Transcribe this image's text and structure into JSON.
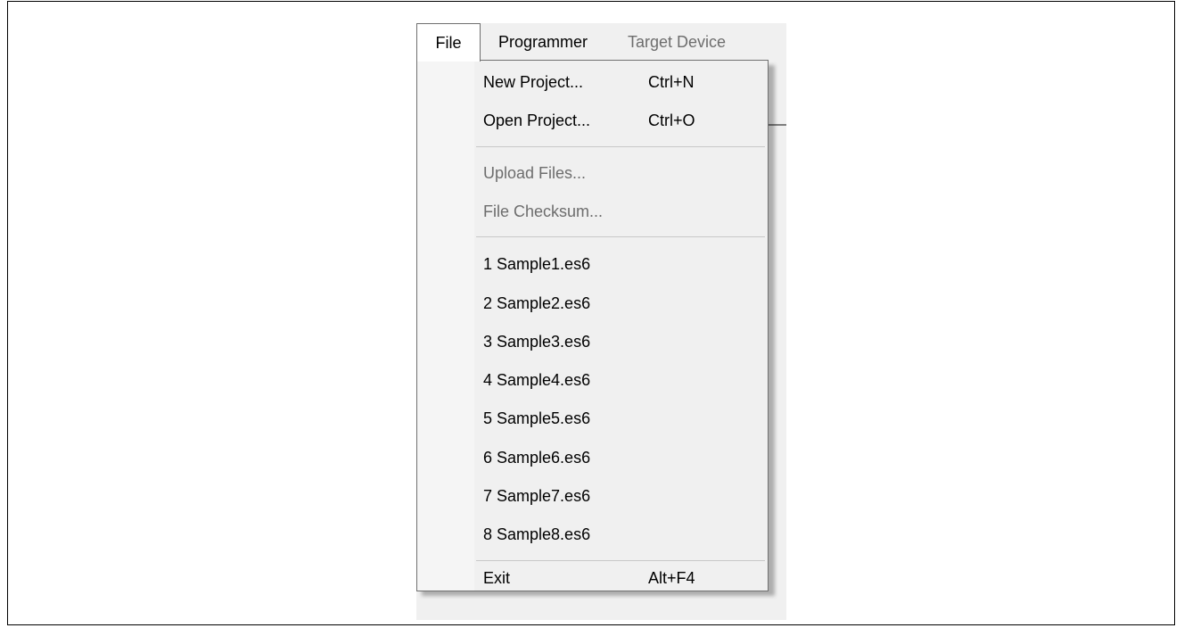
{
  "menubar": {
    "items": [
      {
        "label": "File"
      },
      {
        "label": "Programmer"
      },
      {
        "label": "Target Device"
      }
    ]
  },
  "file_menu": {
    "items": [
      {
        "label": "New Project...",
        "shortcut": "Ctrl+N"
      },
      {
        "label": "Open Project...",
        "shortcut": "Ctrl+O"
      },
      {
        "label": "Upload Files..."
      },
      {
        "label": "File Checksum..."
      },
      {
        "label": "1 Sample1.es6"
      },
      {
        "label": "2 Sample2.es6"
      },
      {
        "label": "3 Sample3.es6"
      },
      {
        "label": "4 Sample4.es6"
      },
      {
        "label": "5 Sample5.es6"
      },
      {
        "label": "6 Sample6.es6"
      },
      {
        "label": "7 Sample7.es6"
      },
      {
        "label": "8 Sample8.es6"
      },
      {
        "label": "Exit",
        "shortcut": "Alt+F4"
      }
    ]
  },
  "colors": {
    "menu_background": "#f0f0f0",
    "disabled_text": "#6d6d6d",
    "border": "#707070"
  }
}
